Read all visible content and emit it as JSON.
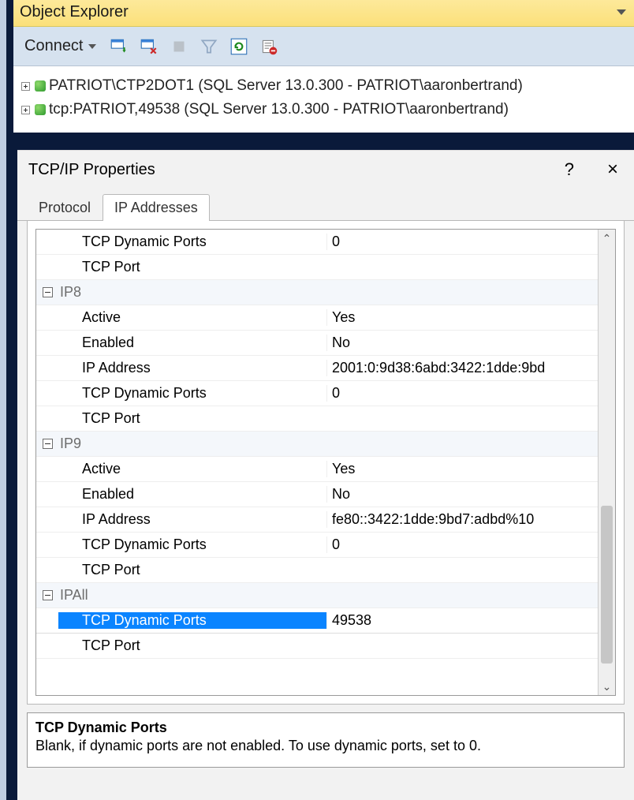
{
  "objectExplorer": {
    "title": "Object Explorer",
    "connectLabel": "Connect",
    "nodes": [
      "PATRIOT\\CTP2DOT1 (SQL Server 13.0.300 - PATRIOT\\aaronbertrand)",
      "tcp:PATRIOT,49538 (SQL Server 13.0.300 - PATRIOT\\aaronbertrand)"
    ]
  },
  "dialog": {
    "title": "TCP/IP Properties",
    "helpGlyph": "?",
    "closeGlyph": "×",
    "tabs": {
      "protocol": "Protocol",
      "ip": "IP Addresses"
    },
    "rows": [
      {
        "type": "prop",
        "label": "TCP Dynamic Ports",
        "value": "0"
      },
      {
        "type": "prop",
        "label": "TCP Port",
        "value": ""
      },
      {
        "type": "header",
        "label": "IP8"
      },
      {
        "type": "prop",
        "label": "Active",
        "value": "Yes"
      },
      {
        "type": "prop",
        "label": "Enabled",
        "value": "No"
      },
      {
        "type": "prop",
        "label": "IP Address",
        "value": "2001:0:9d38:6abd:3422:1dde:9bd"
      },
      {
        "type": "prop",
        "label": "TCP Dynamic Ports",
        "value": "0"
      },
      {
        "type": "prop",
        "label": "TCP Port",
        "value": ""
      },
      {
        "type": "header",
        "label": "IP9"
      },
      {
        "type": "prop",
        "label": "Active",
        "value": "Yes"
      },
      {
        "type": "prop",
        "label": "Enabled",
        "value": "No"
      },
      {
        "type": "prop",
        "label": "IP Address",
        "value": "fe80::3422:1dde:9bd7:adbd%10"
      },
      {
        "type": "prop",
        "label": "TCP Dynamic Ports",
        "value": "0"
      },
      {
        "type": "prop",
        "label": "TCP Port",
        "value": ""
      },
      {
        "type": "header",
        "label": "IPAll"
      },
      {
        "type": "prop",
        "label": "TCP Dynamic Ports",
        "value": "49538",
        "selected": true
      },
      {
        "type": "prop",
        "label": "TCP Port",
        "value": ""
      }
    ],
    "help": {
      "title": "TCP Dynamic Ports",
      "body": "Blank, if dynamic ports are not enabled. To use dynamic ports, set to 0."
    }
  }
}
